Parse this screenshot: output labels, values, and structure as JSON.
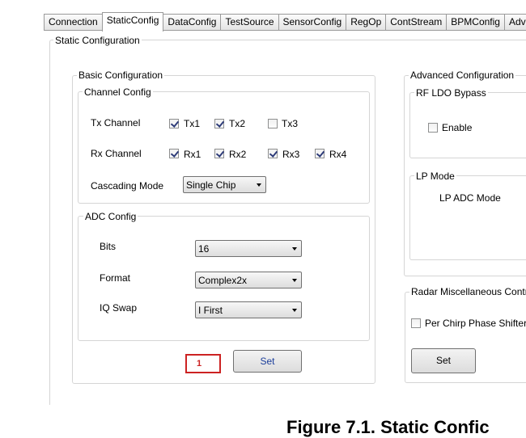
{
  "tabs": [
    "Connection",
    "StaticConfig",
    "DataConfig",
    "TestSource",
    "SensorConfig",
    "RegOp",
    "ContStream",
    "BPMConfig",
    "AdvFra"
  ],
  "static_config": {
    "title": "Static Configuration",
    "basic": {
      "title": "Basic Configuration",
      "channel": {
        "title": "Channel Config",
        "tx_label": "Tx Channel",
        "tx": [
          {
            "label": "Tx1",
            "checked": true
          },
          {
            "label": "Tx2",
            "checked": true
          },
          {
            "label": "Tx3",
            "checked": false
          }
        ],
        "rx_label": "Rx Channel",
        "rx": [
          {
            "label": "Rx1",
            "checked": true
          },
          {
            "label": "Rx2",
            "checked": true
          },
          {
            "label": "Rx3",
            "checked": true
          },
          {
            "label": "Rx4",
            "checked": true
          }
        ],
        "cascade_label": "Cascading Mode",
        "cascade_value": "Single Chip"
      },
      "adc": {
        "title": "ADC Config",
        "bits_label": "Bits",
        "bits_value": "16",
        "format_label": "Format",
        "format_value": "Complex2x",
        "iq_label": "IQ Swap",
        "iq_value": "I First"
      },
      "marker": "1",
      "set_label": "Set"
    },
    "advanced": {
      "title": "Advanced Configuration",
      "rf_ldo": {
        "title": "RF LDO Bypass",
        "enable_label": "Enable",
        "enable_checked": false
      },
      "lp_mode": {
        "title": "LP Mode",
        "adc_mode_label": "LP ADC Mode"
      }
    },
    "radar_misc": {
      "title": "Radar Miscellaneous Contr",
      "phase_label": "Per Chirp Phase Shifter E",
      "phase_checked": false,
      "set_label": "Set"
    }
  },
  "caption": "Figure 7.1. Static Confic"
}
